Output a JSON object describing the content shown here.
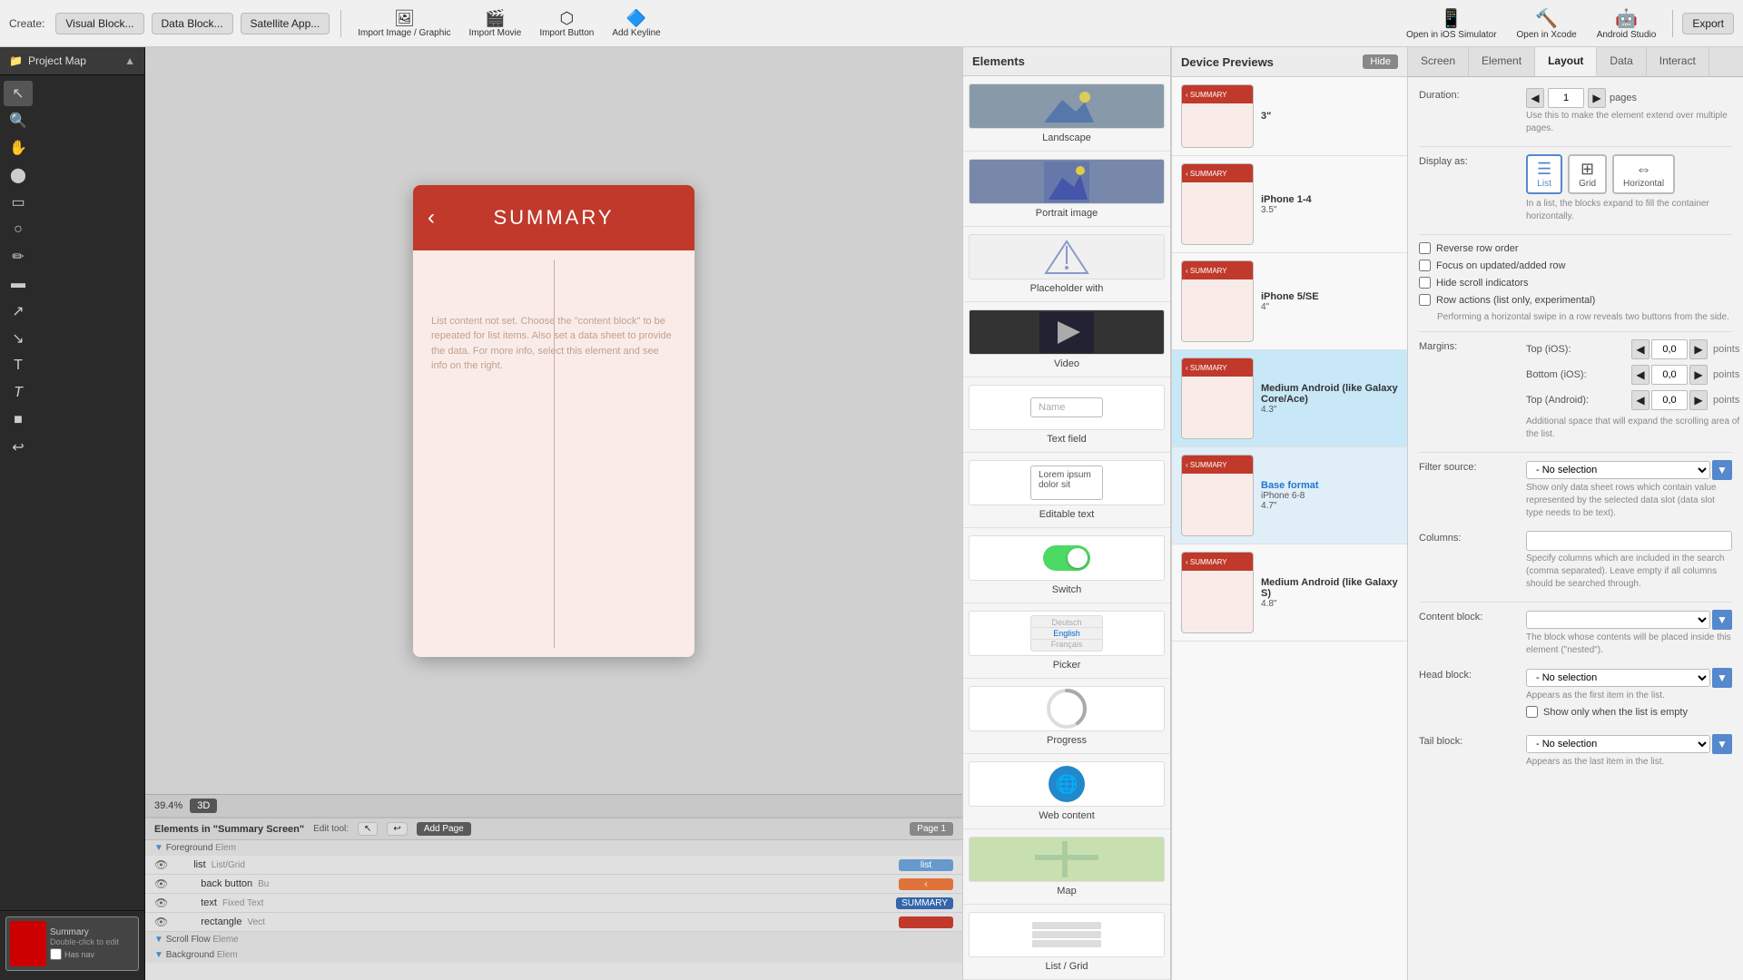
{
  "toolbar": {
    "create_label": "Create:",
    "visual_block_btn": "Visual Block...",
    "data_block_btn": "Data Block...",
    "satellite_app_btn": "Satellite App...",
    "import_image_btn": "Import Image / Graphic",
    "import_movie_btn": "Import Movie",
    "import_button_btn": "Import Button",
    "add_keyline_btn": "Add Keyline",
    "open_ios_btn": "Open in iOS Simulator",
    "open_xcode_btn": "Open in Xcode",
    "android_studio_btn": "Android Studio",
    "export_btn": "Export"
  },
  "left_panel": {
    "project_map_label": "Project Map"
  },
  "canvas": {
    "zoom_label": "39.4%",
    "view_3d": "3D",
    "phone_title": "SUMMARY",
    "phone_back_symbol": "‹",
    "phone_placeholder": "List content not set. Choose the \"content block\" to be repeated for list items. Also set a data sheet to provide the data. For more info, select this element and see info on the right.",
    "elements_label": "Elements in \"Summary Screen\"",
    "edit_tool_label": "Edit tool:",
    "add_page_btn": "Add Page",
    "page_label": "Page 1"
  },
  "elements_list": {
    "sections": [
      {
        "name": "Foreground",
        "type": "Elem",
        "items": [
          {
            "visible": true,
            "indent": 1,
            "name": "list",
            "type": "List/Grid",
            "chip": "list",
            "chip_color": "blue"
          },
          {
            "visible": true,
            "indent": 2,
            "name": "back button",
            "type": "Bu",
            "chip": "‹",
            "chip_color": "orange"
          },
          {
            "visible": true,
            "indent": 2,
            "name": "text",
            "type": "Fixed Text",
            "chip": "SUMMARY",
            "chip_color": "blue-dark"
          },
          {
            "visible": true,
            "indent": 2,
            "name": "rectangle",
            "type": "Vect",
            "chip": "",
            "chip_color": "red"
          }
        ]
      },
      {
        "name": "Scroll Flow",
        "type": "Eleme",
        "items": []
      },
      {
        "name": "Background",
        "type": "Elem",
        "items": []
      }
    ]
  },
  "elements_browser": {
    "title": "Elements",
    "items": [
      {
        "label": "Landscape",
        "preview_type": "image"
      },
      {
        "label": "Portrait image",
        "preview_type": "image"
      },
      {
        "label": "Placeholder with",
        "preview_type": "diamond"
      },
      {
        "label": "Video",
        "preview_type": "video"
      },
      {
        "label": "Text field",
        "preview_type": "textfield"
      },
      {
        "label": "Editable text",
        "preview_type": "edittext"
      },
      {
        "label": "Switch",
        "preview_type": "switch"
      },
      {
        "label": "Picker",
        "preview_type": "picker"
      },
      {
        "label": "Progress",
        "preview_type": "progress"
      },
      {
        "label": "Web content",
        "preview_type": "web"
      },
      {
        "label": "Map",
        "preview_type": "map"
      },
      {
        "label": "List / Grid",
        "preview_type": "listgrid"
      }
    ]
  },
  "device_previews": {
    "title": "Device Previews",
    "hide_btn": "Hide",
    "devices": [
      {
        "name": "3\"",
        "active": false
      },
      {
        "name": "iPhone 1-4",
        "sub": "3.5\"",
        "active": false
      },
      {
        "name": "iPhone 5/SE",
        "sub": "4\"",
        "active": false
      },
      {
        "name": "Medium Android (like Galaxy Core/Ace)",
        "sub": "4.3\"",
        "active": true
      },
      {
        "name": "Base format",
        "sub": "iPhone 6-8 4.7\"",
        "active": false
      },
      {
        "name": "Medium Android (like Galaxy S)",
        "sub": "4.8\"",
        "active": false
      }
    ]
  },
  "props_panel": {
    "tabs": [
      "Screen",
      "Element",
      "Layout",
      "Data",
      "Interact"
    ],
    "active_tab": "Layout",
    "duration_label": "Duration:",
    "duration_value": "1",
    "duration_unit": "pages",
    "duration_desc": "Use this to make the element extend over multiple pages.",
    "display_as_label": "Display as:",
    "display_modes": [
      "List",
      "Grid",
      "Horizontal"
    ],
    "active_mode": "List",
    "display_as_desc": "In a list, the blocks expand to fill the container horizontally.",
    "checkboxes": [
      {
        "label": "Reverse row order"
      },
      {
        "label": "Focus on updated/added row"
      },
      {
        "label": "Hide scroll indicators"
      },
      {
        "label": "Row actions (list only, experimental)",
        "desc": "Performing a horizontal swipe in a row reveals two buttons from the side."
      }
    ],
    "margins_label": "Margins:",
    "margins": [
      {
        "label": "Top (iOS):",
        "value": "0,0",
        "unit": "points"
      },
      {
        "label": "Bottom (iOS):",
        "value": "0,0",
        "unit": "points"
      },
      {
        "label": "Top (Android):",
        "value": "0,0",
        "unit": "points"
      }
    ],
    "margins_desc": "Additional space that will expand the scrolling area of the list.",
    "filter_source_label": "Filter source:",
    "filter_source_value": "- No selection",
    "filter_source_desc": "Show only data sheet rows which contain value represented by the selected data slot (data slot type needs to be text).",
    "columns_label": "Columns:",
    "columns_desc": "Specify columns which are included in the search (comma separated). Leave empty if all columns should be searched through.",
    "content_block_label": "Content block:",
    "content_block_value": "",
    "content_block_desc": "The block whose contents will be placed inside this element (\"nested\").",
    "head_block_label": "Head block:",
    "head_block_value": "- No selection",
    "head_block_desc": "Appears as the first item in the list.",
    "show_when_empty_label": "Show only when the list is empty",
    "tail_block_label": "Tail block:",
    "tail_block_value": "- No selection",
    "tail_block_desc": "Appears as the last item in the list."
  },
  "screen_thumb": {
    "label": "Summary",
    "sub_label": "Double-click to edit",
    "has_nav": "Has nav"
  }
}
